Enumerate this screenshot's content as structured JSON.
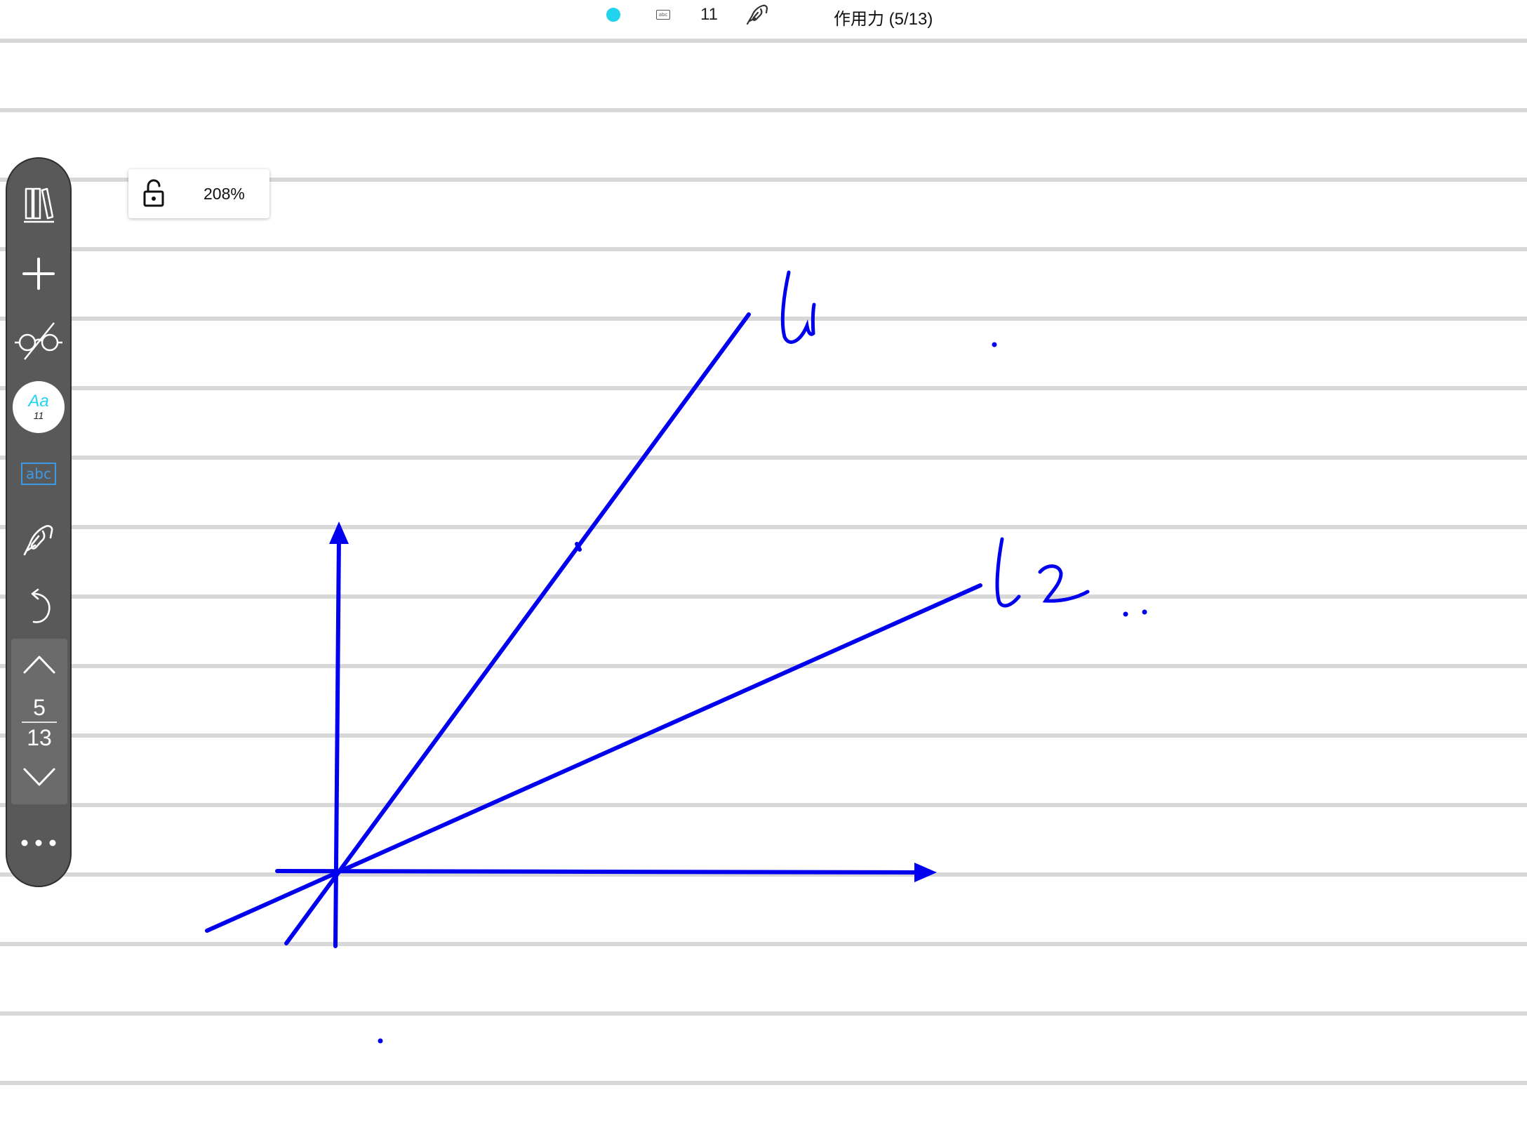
{
  "status_bar": {
    "pen_color": "#22d3ee",
    "text_icon_label": "abc",
    "pen_size": "11",
    "document_title": "作用力 (5/13)"
  },
  "zoom_popup": {
    "lock_icon": "lock-open-icon",
    "zoom_level": "208%"
  },
  "toolbar": {
    "items": [
      {
        "name": "library-icon"
      },
      {
        "name": "add-icon"
      },
      {
        "name": "glasses-icon"
      },
      {
        "name": "font-style-button",
        "sample": "Aa",
        "size": "11"
      },
      {
        "name": "text-box-tool",
        "label": "abc"
      },
      {
        "name": "pen-icon"
      },
      {
        "name": "undo-icon"
      }
    ],
    "page_nav": {
      "current": "5",
      "total": "13"
    },
    "more_icon": "more-icon"
  },
  "canvas": {
    "ink_color": "#0000ee",
    "handwritten_labels": [
      "l1",
      "l2"
    ]
  }
}
